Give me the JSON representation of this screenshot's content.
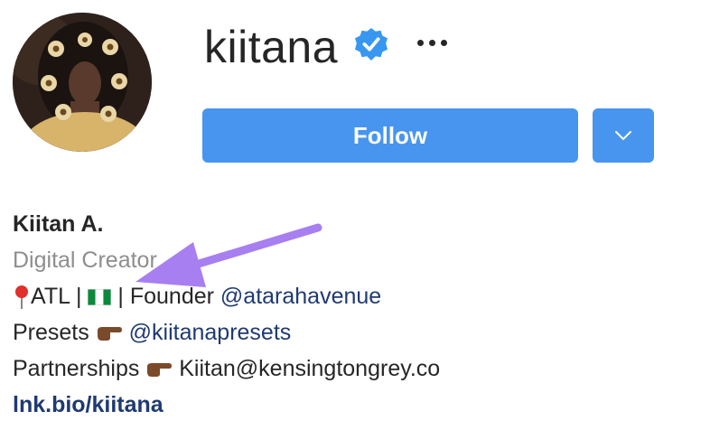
{
  "profile": {
    "username": "kiitana",
    "follow_label": "Follow"
  },
  "bio": {
    "name": "Kiitan A.",
    "category": "Digital Creator",
    "line1_prefix": "ATL | ",
    "line1_mid": " | Founder ",
    "line1_mention": "@atarahavenue",
    "line2_prefix": "Presets ",
    "line2_mention": "@kiitanapresets",
    "line3_prefix": "Partnerships ",
    "line3_email": "Kiitan@kensingtongrey.co",
    "link": "lnk.bio/kiitana"
  },
  "colors": {
    "accent": "#4795ef",
    "mention": "#1f3a72",
    "annotation_arrow": "#a77ff0"
  }
}
